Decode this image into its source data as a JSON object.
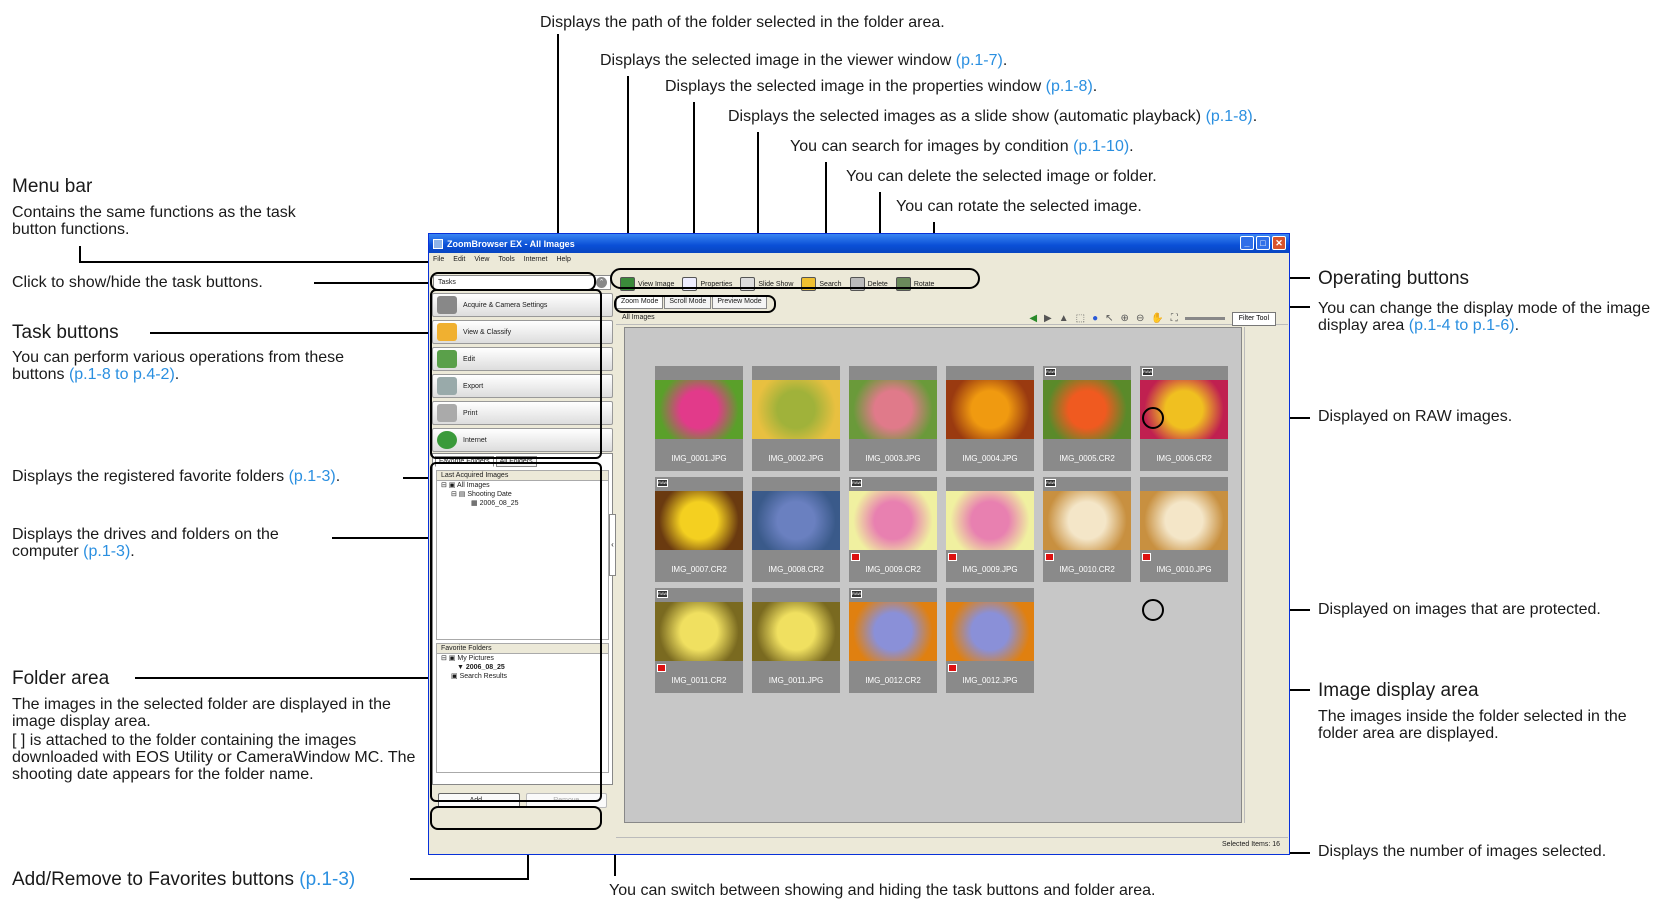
{
  "annotations": {
    "path_text": "Displays the path of the folder selected in the folder area.",
    "viewer_text": "Displays the selected image in the viewer window",
    "viewer_ref": "(p.1-7)",
    "props_text": "Displays the selected image in the properties window",
    "props_ref": "(p.1-8)",
    "slide_text": "Displays the selected images as a slide show (automatic playback)",
    "slide_ref": "(p.1-8)",
    "search_text": "You can search for images by condition",
    "search_ref": "(p.1-10)",
    "delete_text": "You can delete the selected image or folder.",
    "rotate_text": "You can rotate the selected image.",
    "menubar_title": "Menu bar",
    "menubar_desc": "Contains the same functions as the task button functions.",
    "toggle_text": "Click to show/hide the task buttons.",
    "taskbtn_title": "Task buttons",
    "taskbtn_desc": "You can perform various operations from these buttons",
    "taskbtn_ref": "(p.1-8 to p.4-2)",
    "favorites_text": "Displays the registered favorite folders",
    "favorites_ref": "(p.1-3)",
    "drives_text": "Displays the drives and folders on the computer",
    "drives_ref": "(p.1-3)",
    "folderarea_title": "Folder area",
    "folderarea_desc1": "The images in the selected folder are displayed in the image display area.",
    "folderarea_desc2": "[ ] is attached to the folder containing the images downloaded with EOS Utility or CameraWindow MC. The shooting date appears for the folder name.",
    "addremove_text": "Add/Remove to Favorites buttons",
    "addremove_ref": "(p.1-3)",
    "switch_text": "You can switch between showing and hiding the task buttons and folder area.",
    "opbtn_title": "Operating buttons",
    "mode_text": "You can change the display mode of the image display area",
    "mode_ref": "(p.1-4 to p.1-6)",
    "raw_text": "Displayed on RAW images.",
    "protected_text": "Displayed on images that are protected.",
    "imgarea_title": "Image display area",
    "imgarea_desc": "The images inside the folder selected in the folder area are displayed.",
    "selected_text": "Displays the number of images selected."
  },
  "window": {
    "title": "ZoomBrowser EX - All Images",
    "menu": [
      "File",
      "Edit",
      "View",
      "Tools",
      "Internet",
      "Help"
    ],
    "toolbar": [
      "View Image",
      "Properties",
      "Slide Show",
      "Search",
      "Delete",
      "Rotate"
    ],
    "tasks_label": "Tasks",
    "tasks": [
      "Acquire & Camera Settings",
      "View & Classify",
      "Edit",
      "Export",
      "Print",
      "Internet"
    ],
    "folder_tabs": [
      "Favorite Folders",
      "All Folders"
    ],
    "tree1_header": "Last Acquired Images",
    "tree1": [
      "All Images",
      "Shooting Date",
      "2006_08_25"
    ],
    "tree2_header": "Favorite Folders",
    "tree2": [
      "My Pictures",
      "2006_08_25",
      "Search Results"
    ],
    "add_label": "Add...",
    "remove_label": "Remove",
    "mode_tabs": [
      "Zoom Mode",
      "Scroll Mode",
      "Preview Mode"
    ],
    "path": "All Images",
    "filter_label": "Filter Tool",
    "status": "Selected Items: 16",
    "thumbs": [
      {
        "name": "IMG_0001.JPG",
        "raw": false,
        "prot": false,
        "c1": "#e23a8a",
        "c2": "#5aa02a"
      },
      {
        "name": "IMG_0002.JPG",
        "raw": false,
        "prot": false,
        "c1": "#a0b23a",
        "c2": "#e8c040"
      },
      {
        "name": "IMG_0003.JPG",
        "raw": false,
        "prot": false,
        "c1": "#e07a8a",
        "c2": "#6a9a3a"
      },
      {
        "name": "IMG_0004.JPG",
        "raw": false,
        "prot": false,
        "c1": "#f09a10",
        "c2": "#9a3a10"
      },
      {
        "name": "IMG_0005.CR2",
        "raw": true,
        "prot": false,
        "c1": "#f05a20",
        "c2": "#5a8a2a"
      },
      {
        "name": "IMG_0006.CR2",
        "raw": true,
        "prot": false,
        "c1": "#f0c020",
        "c2": "#c02050"
      },
      {
        "name": "IMG_0007.CR2",
        "raw": true,
        "prot": false,
        "c1": "#f4d020",
        "c2": "#6a3a10"
      },
      {
        "name": "IMG_0008.CR2",
        "raw": false,
        "prot": false,
        "c1": "#6a80c0",
        "c2": "#3a5a8a"
      },
      {
        "name": "IMG_0009.CR2",
        "raw": true,
        "prot": true,
        "c1": "#e880b0",
        "c2": "#f0f0a0"
      },
      {
        "name": "IMG_0009.JPG",
        "raw": false,
        "prot": true,
        "c1": "#e880b0",
        "c2": "#f0f0a0"
      },
      {
        "name": "IMG_0010.CR2",
        "raw": true,
        "prot": true,
        "c1": "#f4e6c8",
        "c2": "#c89040"
      },
      {
        "name": "IMG_0010.JPG",
        "raw": false,
        "prot": true,
        "c1": "#f4e6c8",
        "c2": "#c89040"
      },
      {
        "name": "IMG_0011.CR2",
        "raw": true,
        "prot": true,
        "c1": "#f0e060",
        "c2": "#7a6a20"
      },
      {
        "name": "IMG_0011.JPG",
        "raw": false,
        "prot": false,
        "c1": "#f0e060",
        "c2": "#7a6a20"
      },
      {
        "name": "IMG_0012.CR2",
        "raw": true,
        "prot": false,
        "c1": "#8a90d8",
        "c2": "#e08010"
      },
      {
        "name": "IMG_0012.JPG",
        "raw": false,
        "prot": true,
        "c1": "#8a90d8",
        "c2": "#e08010"
      }
    ]
  },
  "colors": {
    "ref": "#2a8fe0",
    "titlebar": "#0a4fd6"
  }
}
